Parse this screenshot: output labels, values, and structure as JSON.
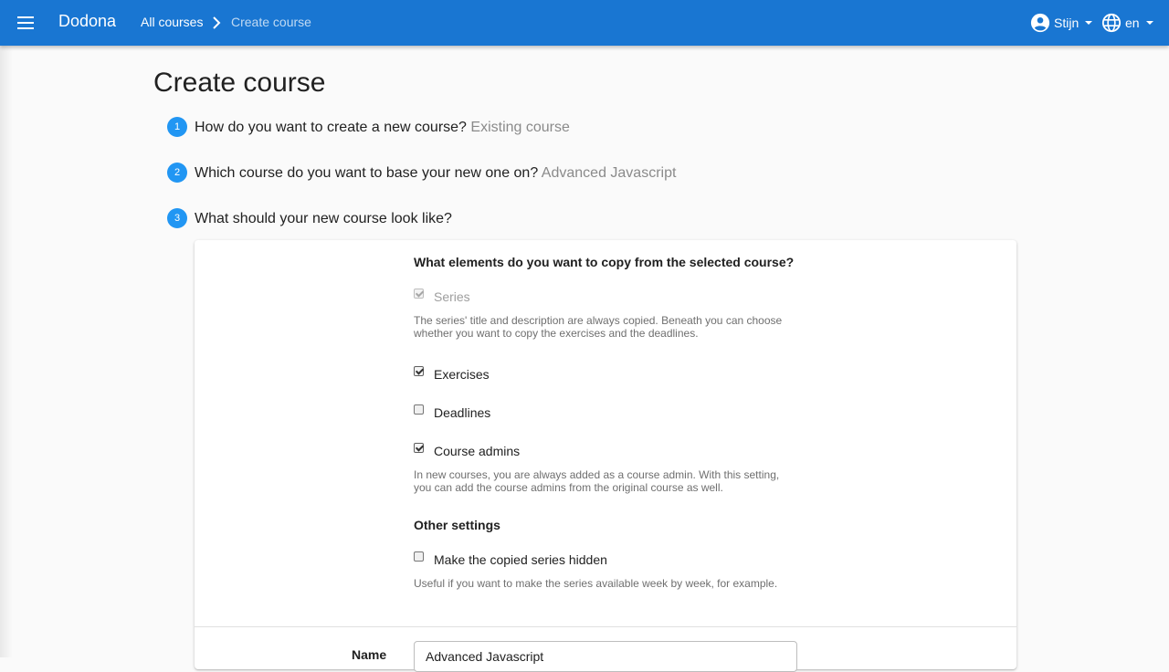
{
  "navbar": {
    "brand": "Dodona",
    "breadcrumb": {
      "link": "All courses",
      "current": "Create course"
    },
    "user": {
      "name": "Stijn"
    },
    "language": {
      "code": "en"
    },
    "color": "#1976d2"
  },
  "page": {
    "title": "Create course"
  },
  "steps": [
    {
      "number": "1",
      "question": "How do you want to create a new course?",
      "answer": "Existing course"
    },
    {
      "number": "2",
      "question": "Which course do you want to base your new one on?",
      "answer": "Advanced Javascript"
    },
    {
      "number": "3",
      "question": "What should your new course look like?",
      "answer": ""
    }
  ],
  "form": {
    "copy_heading": "What elements do you want to copy from the selected course?",
    "series": {
      "label": "Series",
      "checked": true,
      "disabled": true
    },
    "series_help": "The series' title and description are always copied. Beneath you can choose whether you want to copy the exercises and the deadlines.",
    "exercises": {
      "label": "Exercises",
      "checked": true
    },
    "deadlines": {
      "label": "Deadlines",
      "checked": false
    },
    "course_admins": {
      "label": "Course admins",
      "checked": true
    },
    "admins_help": "In new courses, you are always added as a course admin. With this setting, you can add the course admins from the original course as well.",
    "other_heading": "Other settings",
    "hidden": {
      "label": "Make the copied series hidden",
      "checked": false
    },
    "hidden_help": "Useful if you want to make the series available week by week, for example.",
    "name_label": "Name",
    "name_value": "Advanced Javascript"
  },
  "colors": {
    "accent": "#2196f3",
    "muted_text": "#8a8a8a"
  }
}
